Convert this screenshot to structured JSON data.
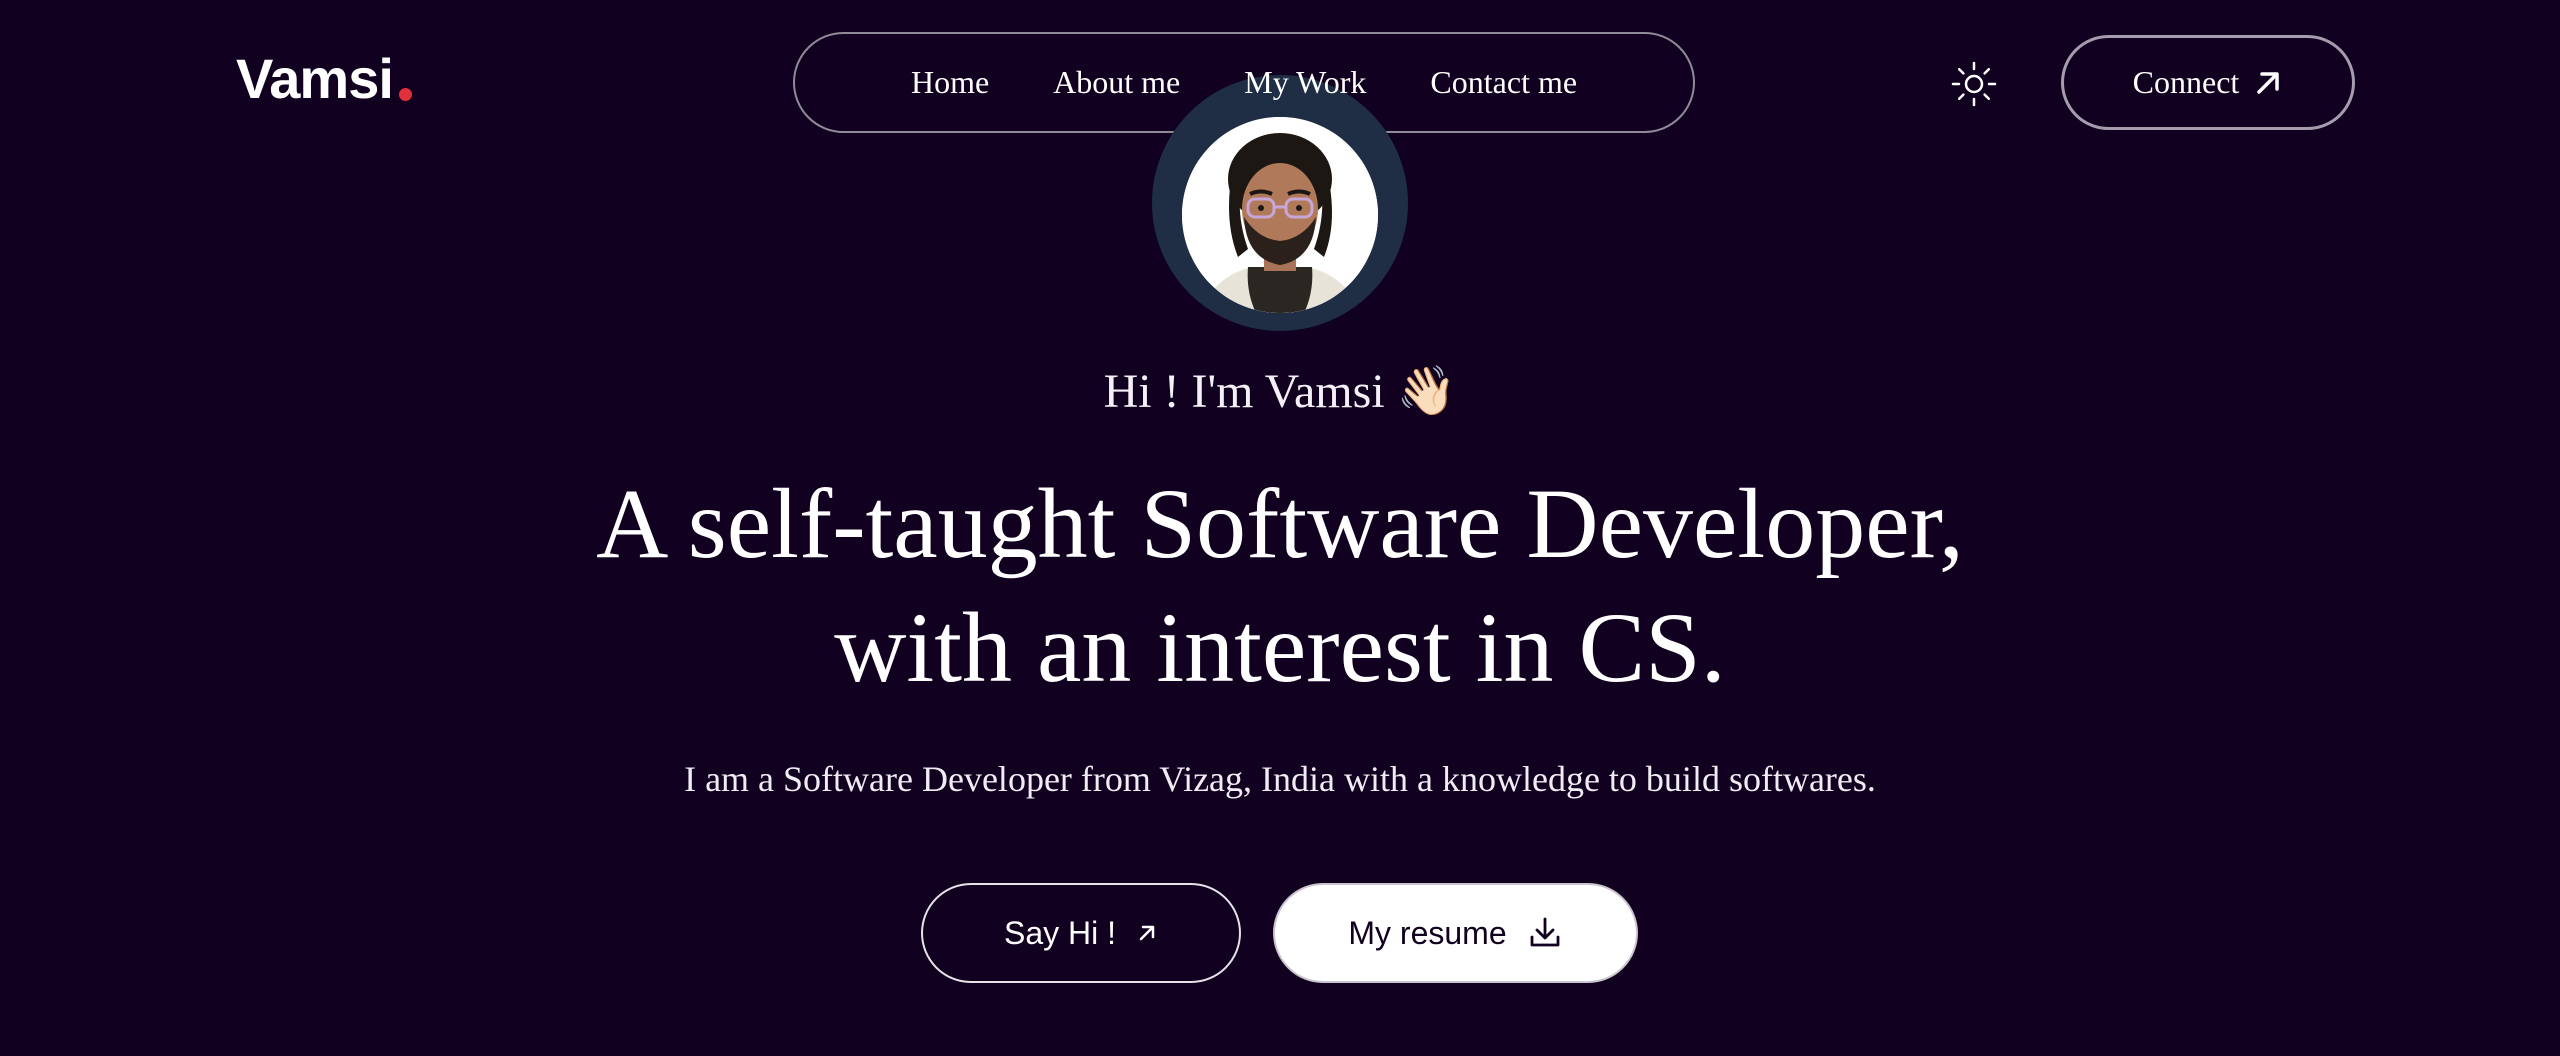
{
  "brand": {
    "name": "Vamsi",
    "dot_color": "#e0303a"
  },
  "nav": {
    "items": [
      {
        "label": "Home"
      },
      {
        "label": "About me"
      },
      {
        "label": "My Work"
      },
      {
        "label": "Contact me"
      }
    ]
  },
  "header": {
    "theme_icon": "sun-icon",
    "connect_label": "Connect",
    "connect_icon": "arrow-up-right-icon"
  },
  "hero": {
    "greeting": "Hi ! I'm Vamsi 👋🏻",
    "headline_line1": "A self-taught Software Developer,",
    "headline_line2": "with an interest in CS.",
    "subtitle": "I am a Software Developer from Vizag, India with a knowledge to build softwares.",
    "say_hi_label": "Say Hi !",
    "say_hi_icon": "arrow-up-right-icon",
    "resume_label": "My resume",
    "resume_icon": "download-icon"
  },
  "colors": {
    "background": "#11001f",
    "avatar_ring": "#1f2d45",
    "accent_dot": "#e0303a"
  }
}
